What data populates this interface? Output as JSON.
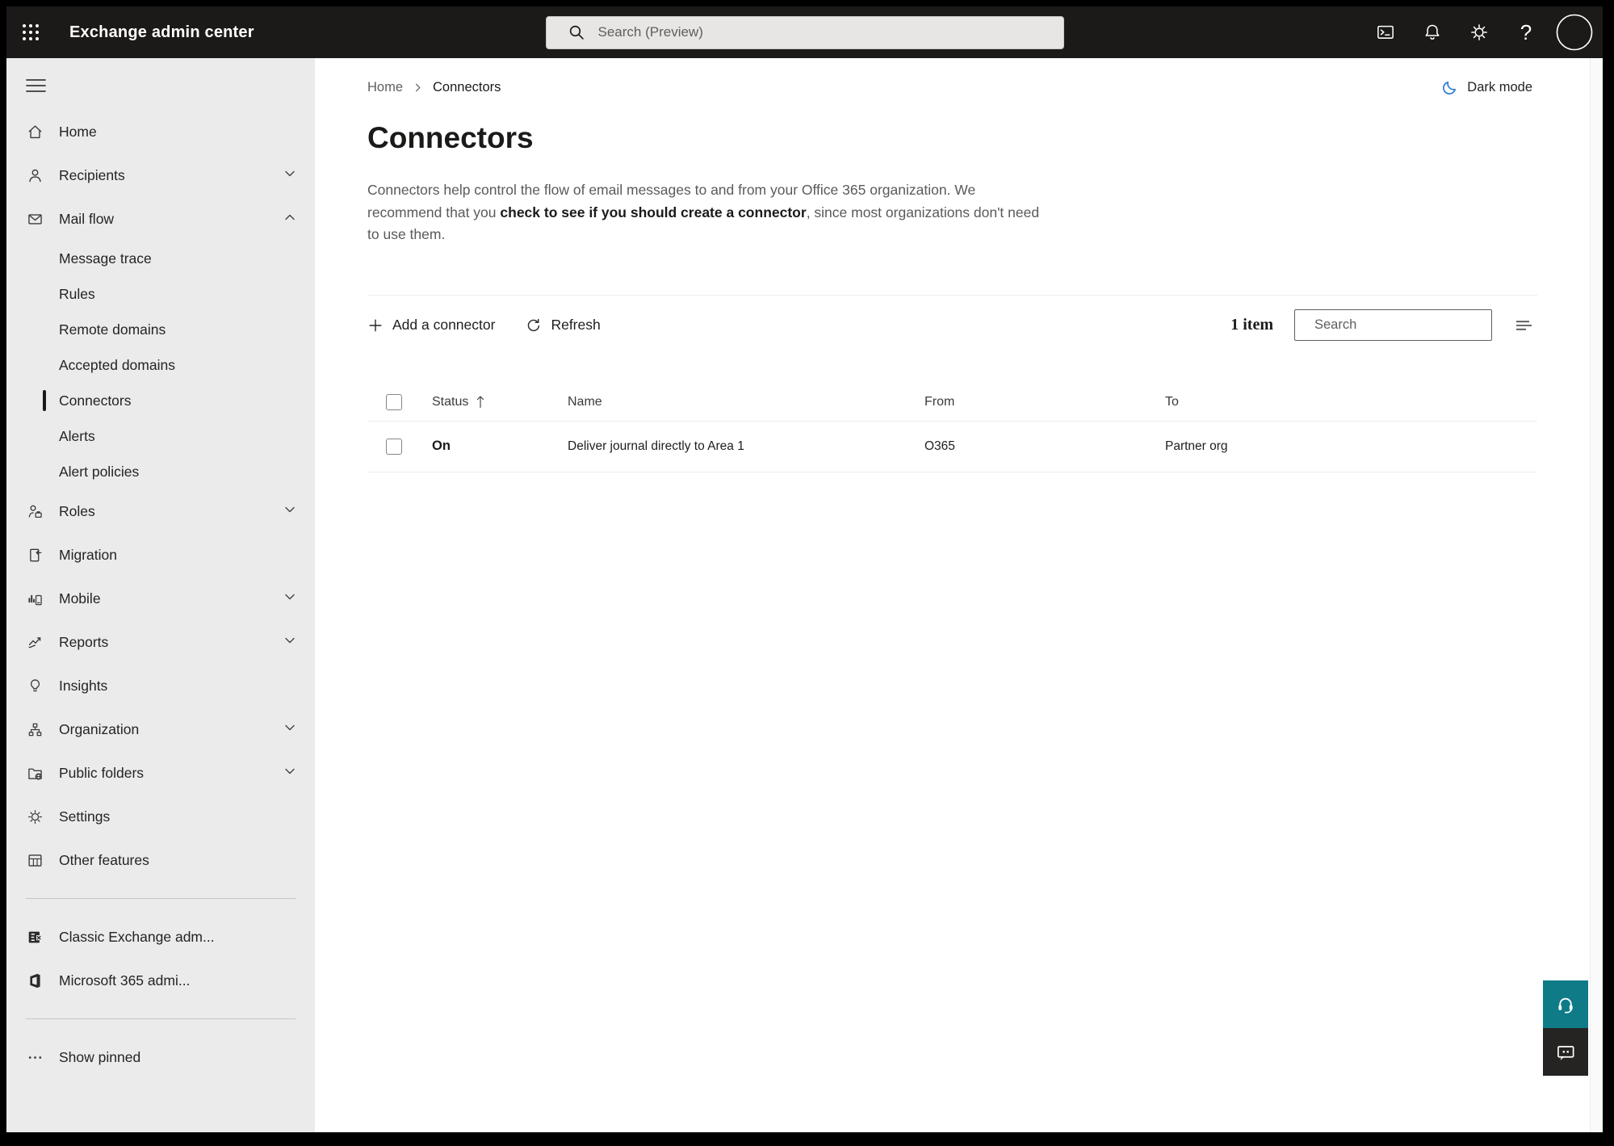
{
  "topbar": {
    "title": "Exchange admin center",
    "search_placeholder": "Search (Preview)"
  },
  "breadcrumb": {
    "home": "Home",
    "current": "Connectors"
  },
  "dark_mode_label": "Dark mode",
  "page": {
    "title": "Connectors",
    "desc_pre": "Connectors help control the flow of email messages to and from your Office 365 organization. We recommend that you ",
    "desc_link": "check to see if you should create a connector",
    "desc_post": ", since most organizations don't need to use them."
  },
  "toolbar": {
    "add_label": "Add a connector",
    "refresh_label": "Refresh",
    "item_count": "1 item",
    "search_placeholder": "Search"
  },
  "table": {
    "columns": {
      "status": "Status",
      "name": "Name",
      "from": "From",
      "to": "To"
    },
    "rows": [
      {
        "status": "On",
        "name": "Deliver journal directly to Area 1",
        "from": "O365",
        "to": "Partner org"
      }
    ]
  },
  "sidebar": {
    "items": [
      {
        "label": "Home"
      },
      {
        "label": "Recipients"
      },
      {
        "label": "Mail flow"
      },
      {
        "label": "Message trace"
      },
      {
        "label": "Rules"
      },
      {
        "label": "Remote domains"
      },
      {
        "label": "Accepted domains"
      },
      {
        "label": "Connectors"
      },
      {
        "label": "Alerts"
      },
      {
        "label": "Alert policies"
      },
      {
        "label": "Roles"
      },
      {
        "label": "Migration"
      },
      {
        "label": "Mobile"
      },
      {
        "label": "Reports"
      },
      {
        "label": "Insights"
      },
      {
        "label": "Organization"
      },
      {
        "label": "Public folders"
      },
      {
        "label": "Settings"
      },
      {
        "label": "Other features"
      },
      {
        "label": "Classic Exchange adm..."
      },
      {
        "label": "Microsoft 365 admi..."
      },
      {
        "label": "Show pinned"
      }
    ]
  },
  "colors": {
    "topbar_bg": "#1b1a19",
    "sidebar_bg": "#ebebeb",
    "accent_teal": "#0f7b87",
    "moon_blue": "#2b7cd3",
    "selected_indicator": "#1b1a19"
  }
}
